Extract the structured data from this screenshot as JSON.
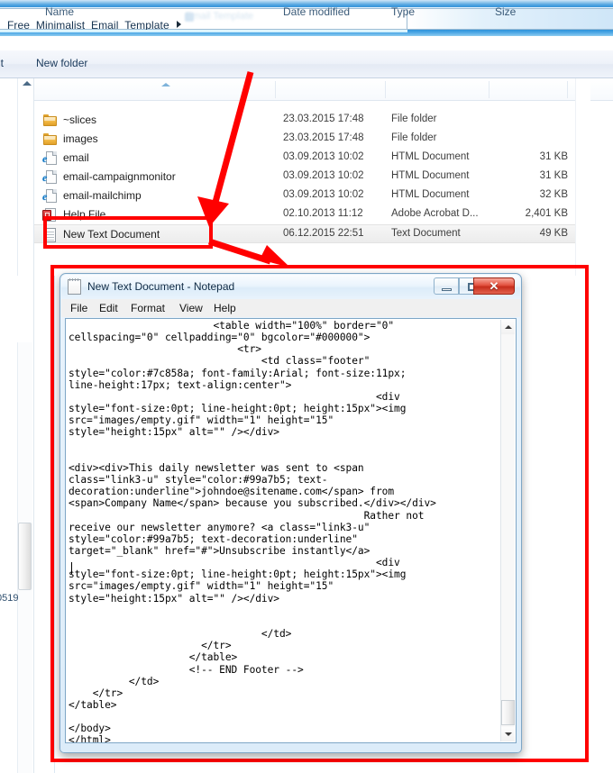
{
  "explorer": {
    "breadcrumb": "Free_Minimalist_Email_Template",
    "breadcrumb_ghost": "Email Template",
    "commandbar": {
      "print_label": "nt",
      "new_folder_label": "New folder"
    },
    "columns": [
      {
        "label": "Name"
      },
      {
        "label": "Date modified"
      },
      {
        "label": "Type"
      },
      {
        "label": "Size"
      }
    ],
    "rows": [
      {
        "icon": "folder-icon",
        "name": "~slices",
        "date": "23.03.2015 17:48",
        "type": "File folder",
        "size": ""
      },
      {
        "icon": "folder-icon",
        "name": "images",
        "date": "23.03.2015 17:48",
        "type": "File folder",
        "size": ""
      },
      {
        "icon": "ie-html-icon",
        "name": "email",
        "date": "03.09.2013 10:02",
        "type": "HTML Document",
        "size": "31 KB"
      },
      {
        "icon": "ie-html-icon",
        "name": "email-campaignmonitor",
        "date": "03.09.2013 10:02",
        "type": "HTML Document",
        "size": "31 KB"
      },
      {
        "icon": "ie-html-icon",
        "name": "email-mailchimp",
        "date": "03.09.2013 10:02",
        "type": "HTML Document",
        "size": "32 KB"
      },
      {
        "icon": "pdf-icon",
        "name": "Help File",
        "date": "02.10.2013 11:12",
        "type": "Adobe Acrobat D...",
        "size": "2,401 KB"
      },
      {
        "icon": "text-doc-icon",
        "name": "New Text Document",
        "date": "06.12.2015 22:51",
        "type": "Text Document",
        "size": "49 KB"
      }
    ],
    "clipped_left_text": "0519"
  },
  "annotations": {
    "highlight_color": "#ff0000",
    "shapes": [
      "rect-around-new-text-document",
      "arrow-to-file-row",
      "arrow-to-notepad",
      "rect-around-notepad-window"
    ]
  },
  "notepad": {
    "title": "New Text Document - Notepad",
    "menu": [
      "File",
      "Edit",
      "Format",
      "View",
      "Help"
    ],
    "window_buttons": {
      "minimize": "minimize-button",
      "maximize": "maximize-button",
      "close_label": "✕"
    },
    "content": "                        <table width=\"100%\" border=\"0\"\ncellspacing=\"0\" cellpadding=\"0\" bgcolor=\"#000000\">\n                            <tr>\n                                <td class=\"footer\"\nstyle=\"color:#7c858a; font-family:Arial; font-size:11px;\nline-height:17px; text-align:center\">\n                                                   <div\nstyle=\"font-size:0pt; line-height:0pt; height:15px\"><img\nsrc=\"images/empty.gif\" width=\"1\" height=\"15\"\nstyle=\"height:15px\" alt=\"\" /></div>\n\n\n<div><div>This daily newsletter was sent to <span\nclass=\"link3-u\" style=\"color:#99a7b5; text-\ndecoration:underline\">johndoe@sitename.com</span> from\n<span>Company Name</span> because you subscribed.</div></div>\n                                                 Rather not\nreceive our newsletter anymore? <a class=\"link3-u\"\nstyle=\"color:#99a7b5; text-decoration:underline\"\ntarget=\"_blank\" href=\"#\">Unsubscribe instantly</a>\n                                                   <div\nstyle=\"font-size:0pt; line-height:0pt; height:15px\"><img\nsrc=\"images/empty.gif\" width=\"1\" height=\"15\"\nstyle=\"height:15px\" alt=\"\" /></div>\n\n\n                                </td>\n                      </tr>\n                    </table>\n                    <!-- END Footer -->\n          </td>\n    </tr>\n</table>\n\n</body>\n</html>"
  }
}
